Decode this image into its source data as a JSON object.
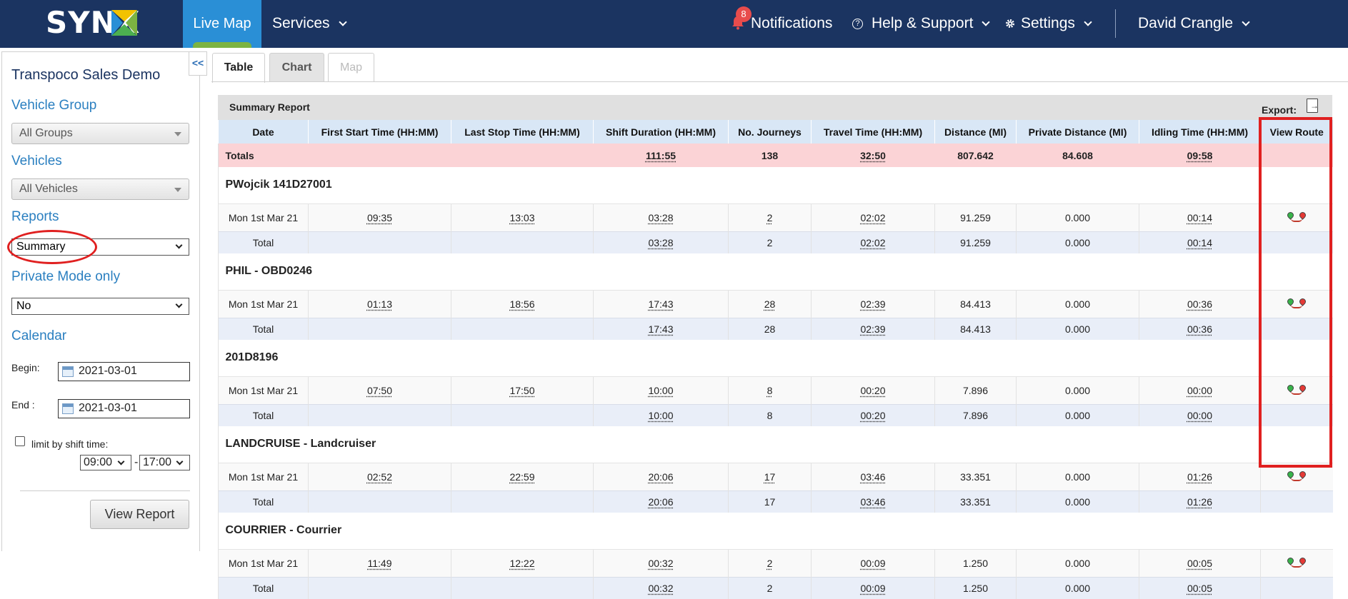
{
  "nav": {
    "logo": "SYNX",
    "live_map": "Live Map",
    "services": "Services",
    "notifications_count": "8",
    "notifications": "Notifications",
    "help": "Help & Support",
    "settings": "Settings",
    "user": "David Crangle",
    "colors": {
      "bar": "#1b3461",
      "active": "#2a8fd6",
      "accent": "#7cb342"
    }
  },
  "sidebar": {
    "company": "Transpoco Sales Demo",
    "vehicle_group_label": "Vehicle Group",
    "vehicle_group_value": "All Groups",
    "vehicles_label": "Vehicles",
    "vehicles_value": "All Vehicles",
    "reports_label": "Reports",
    "reports_value": "Summary",
    "private_mode_label": "Private Mode only",
    "private_mode_value": "No",
    "calendar_label": "Calendar",
    "begin_label": "Begin:",
    "begin_value": "2021-03-01",
    "end_label": "End :",
    "end_value": "2021-03-01",
    "limit_label": "limit by shift time:",
    "shift_start": "09:00",
    "shift_sep": "-",
    "shift_end": "17:00",
    "view_report": "View Report",
    "collapse": "<<"
  },
  "tabs": {
    "table": "Table",
    "chart": "Chart",
    "map": "Map"
  },
  "report": {
    "title": "Summary Report",
    "export": "Export:",
    "columns": [
      "Date",
      "First Start Time (HH:MM)",
      "Last Stop Time (HH:MM)",
      "Shift Duration (HH:MM)",
      "No. Journeys",
      "Travel Time (HH:MM)",
      "Distance (MI)",
      "Private Distance (MI)",
      "Idling Time (HH:MM)",
      "View Route"
    ],
    "totals": {
      "label": "Totals",
      "shift": "111:55",
      "journeys": "138",
      "travel": "32:50",
      "distance": "807.642",
      "private": "84.608",
      "idling": "09:58"
    },
    "vehicles": [
      {
        "name": "PWojcik 141D27001",
        "day": {
          "date": "Mon 1st Mar 21",
          "first": "09:35",
          "last": "13:03",
          "shift": "03:28",
          "journeys": "2",
          "travel": "02:02",
          "distance": "91.259",
          "private": "0.000",
          "idling": "00:14"
        },
        "total": {
          "label": "Total",
          "shift": "03:28",
          "journeys": "2",
          "travel": "02:02",
          "distance": "91.259",
          "private": "0.000",
          "idling": "00:14"
        }
      },
      {
        "name": "PHIL - OBD0246",
        "day": {
          "date": "Mon 1st Mar 21",
          "first": "01:13",
          "last": "18:56",
          "shift": "17:43",
          "journeys": "28",
          "travel": "02:39",
          "distance": "84.413",
          "private": "0.000",
          "idling": "00:36"
        },
        "total": {
          "label": "Total",
          "shift": "17:43",
          "journeys": "28",
          "travel": "02:39",
          "distance": "84.413",
          "private": "0.000",
          "idling": "00:36"
        }
      },
      {
        "name": "201D8196",
        "day": {
          "date": "Mon 1st Mar 21",
          "first": "07:50",
          "last": "17:50",
          "shift": "10:00",
          "journeys": "8",
          "travel": "00:20",
          "distance": "7.896",
          "private": "0.000",
          "idling": "00:00"
        },
        "total": {
          "label": "Total",
          "shift": "10:00",
          "journeys": "8",
          "travel": "00:20",
          "distance": "7.896",
          "private": "0.000",
          "idling": "00:00"
        }
      },
      {
        "name": "LANDCRUISE - Landcruiser",
        "day": {
          "date": "Mon 1st Mar 21",
          "first": "02:52",
          "last": "22:59",
          "shift": "20:06",
          "journeys": "17",
          "travel": "03:46",
          "distance": "33.351",
          "private": "0.000",
          "idling": "01:26"
        },
        "total": {
          "label": "Total",
          "shift": "20:06",
          "journeys": "17",
          "travel": "03:46",
          "distance": "33.351",
          "private": "0.000",
          "idling": "01:26"
        }
      },
      {
        "name": "COURRIER - Courrier",
        "day": {
          "date": "Mon 1st Mar 21",
          "first": "11:49",
          "last": "12:22",
          "shift": "00:32",
          "journeys": "2",
          "travel": "00:09",
          "distance": "1.250",
          "private": "0.000",
          "idling": "00:05"
        },
        "total": {
          "label": "Total",
          "shift": "00:32",
          "journeys": "2",
          "travel": "00:09",
          "distance": "1.250",
          "private": "0.000",
          "idling": "00:05"
        }
      }
    ]
  }
}
